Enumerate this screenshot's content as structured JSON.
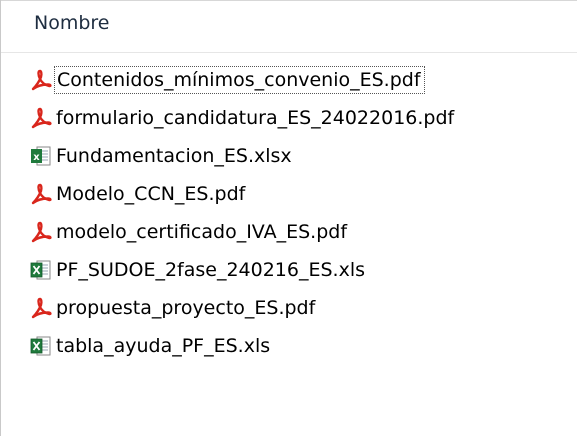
{
  "column_header": "Nombre",
  "files": [
    {
      "name": "Contenidos_mínimos_convenio_ES.pdf",
      "icon": "pdf-icon",
      "focused": true
    },
    {
      "name": "formulario_candidatura_ES_24022016.pdf",
      "icon": "pdf-icon",
      "focused": false
    },
    {
      "name": "Fundamentacion_ES.xlsx",
      "icon": "xlsx-icon",
      "focused": false
    },
    {
      "name": "Modelo_CCN_ES.pdf",
      "icon": "pdf-icon",
      "focused": false
    },
    {
      "name": "modelo_certificado_IVA_ES.pdf",
      "icon": "pdf-icon",
      "focused": false
    },
    {
      "name": "PF_SUDOE_2fase_240216_ES.xls",
      "icon": "xls-icon",
      "focused": false
    },
    {
      "name": "propuesta_proyecto_ES.pdf",
      "icon": "pdf-icon",
      "focused": false
    },
    {
      "name": "tabla_ayuda_PF_ES.xls",
      "icon": "xls-icon",
      "focused": false
    }
  ],
  "colors": {
    "pdf_red": "#d9261c",
    "excel_green": "#1f7a3c",
    "header_text": "#1e2d40"
  }
}
